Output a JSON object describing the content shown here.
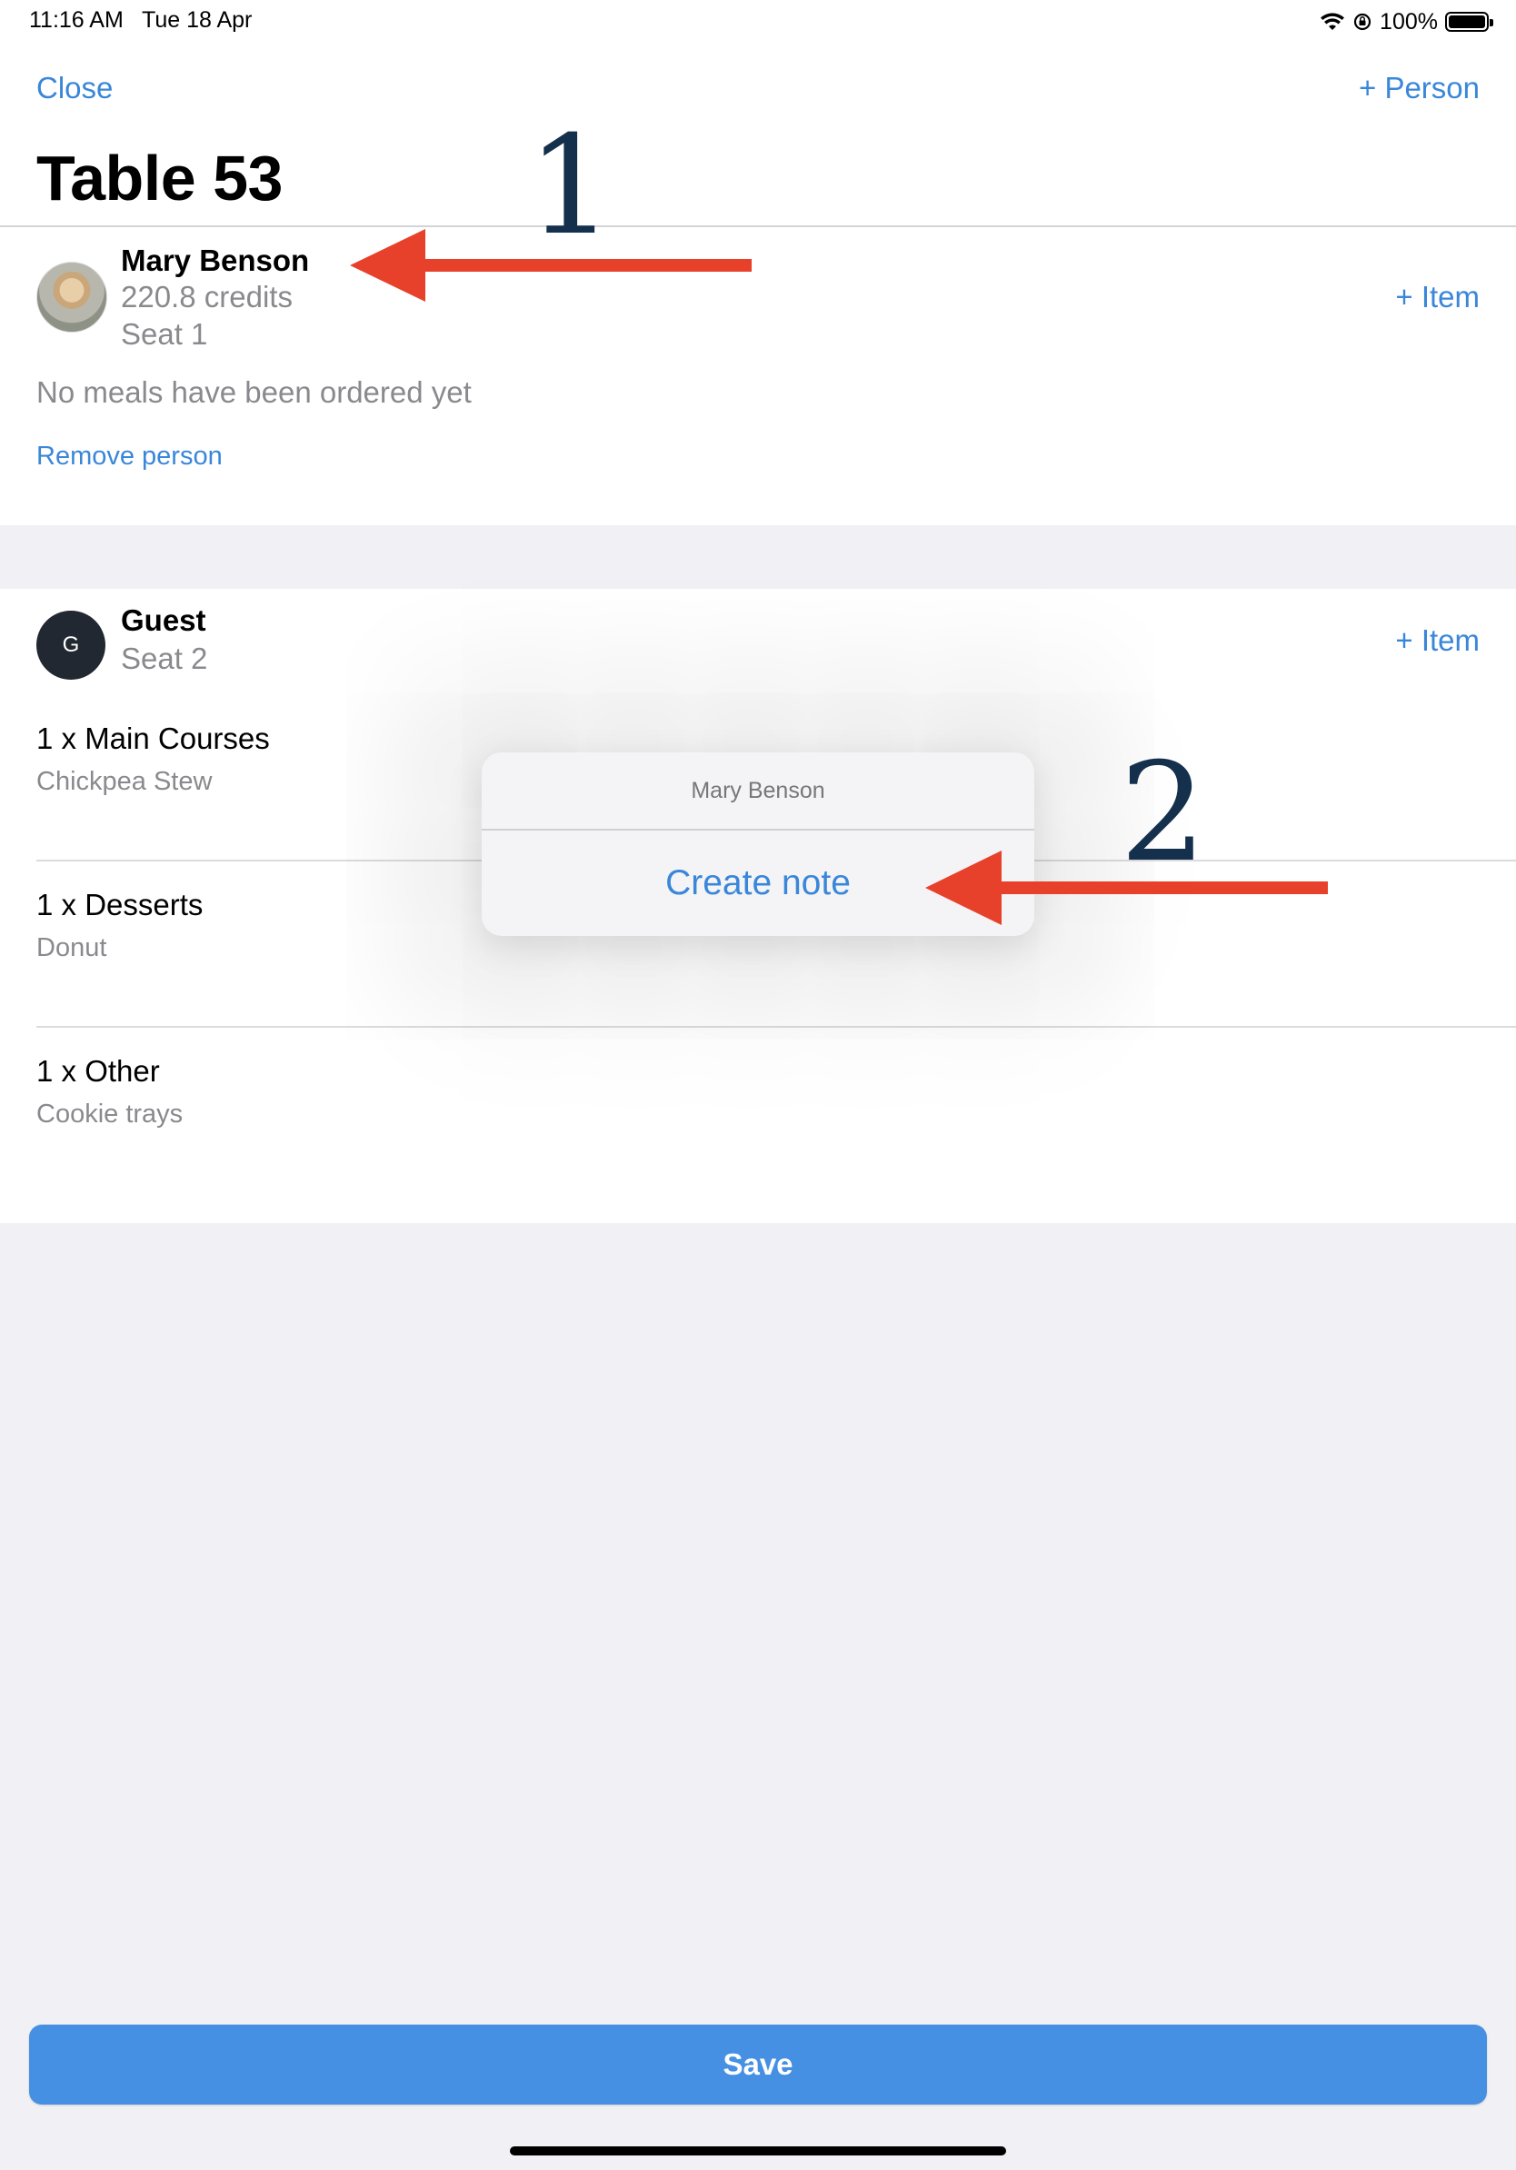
{
  "status_bar": {
    "time": "11:16 AM",
    "date": "Tue 18 Apr",
    "battery": "100%",
    "icons": [
      "wifi-icon",
      "orientation-lock-icon",
      "battery-icon"
    ]
  },
  "nav": {
    "close_label": "Close",
    "add_person_label": "+ Person",
    "title": "Table 53"
  },
  "people": [
    {
      "name": "Mary Benson",
      "credits": "220.8 credits",
      "seat": "Seat 1",
      "add_item_label": "+ Item",
      "empty_text": "No meals have been ordered yet",
      "remove_label": "Remove person"
    },
    {
      "name": "Guest",
      "initial": "G",
      "seat": "Seat 2",
      "add_item_label": "+ Item",
      "orders": [
        {
          "qty_category": "1 x Main Courses",
          "item": "Chickpea Stew"
        },
        {
          "qty_category": "1 x Desserts",
          "item": "Donut"
        },
        {
          "qty_category": "1 x Other",
          "item": "Cookie trays"
        }
      ]
    }
  ],
  "popover": {
    "title": "Mary Benson",
    "action_label": "Create note"
  },
  "annotations": {
    "step1": "1",
    "step2": "2",
    "arrow_color": "#e8412b",
    "number_color": "#14304d"
  },
  "footer": {
    "save_label": "Save"
  },
  "colors": {
    "accent": "#3a87d9",
    "save_button": "#4590e3",
    "background": "#f1f1f5"
  }
}
